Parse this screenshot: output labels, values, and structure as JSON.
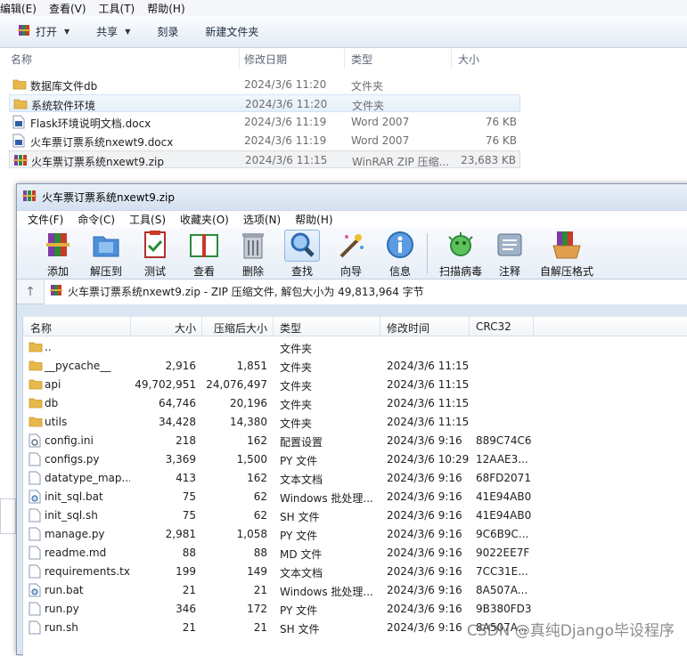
{
  "explorer": {
    "menu": [
      "编辑(E)",
      "查看(V)",
      "工具(T)",
      "帮助(H)"
    ],
    "commands": [
      {
        "label": "打开",
        "dropdown": true
      },
      {
        "label": "共享",
        "dropdown": true
      },
      {
        "label": "刻录",
        "dropdown": false
      },
      {
        "label": "新建文件夹",
        "dropdown": false
      }
    ],
    "columns": {
      "name": "名称",
      "date": "修改日期",
      "type": "类型",
      "size": "大小"
    },
    "files": [
      {
        "name": "数据库文件db",
        "date": "2024/3/6 11:20",
        "type": "文件夹",
        "size": "",
        "icon": "folder-icon"
      },
      {
        "name": "系统软件环境",
        "date": "2024/3/6 11:20",
        "type": "文件夹",
        "size": "",
        "icon": "folder-icon"
      },
      {
        "name": "Flask环境说明文档.docx",
        "date": "2024/3/6 11:19",
        "type": "Word 2007",
        "size": "76 KB",
        "icon": "docx-icon"
      },
      {
        "name": "火车票订票系统nxewt9.docx",
        "date": "2024/3/6 11:19",
        "type": "Word 2007",
        "size": "76 KB",
        "icon": "docx-icon"
      },
      {
        "name": "火车票订票系统nxewt9.zip",
        "date": "2024/3/6 11:15",
        "type": "WinRAR ZIP 压缩...",
        "size": "23,683 KB",
        "icon": "winrar-icon"
      }
    ]
  },
  "winrar": {
    "title": "火车票订票系统nxewt9.zip",
    "menu": [
      "文件(F)",
      "命令(C)",
      "工具(S)",
      "收藏夹(O)",
      "选项(N)",
      "帮助(H)"
    ],
    "toolbar": [
      {
        "label": "添加",
        "icon": "add-icon"
      },
      {
        "label": "解压到",
        "icon": "extract-icon"
      },
      {
        "label": "测试",
        "icon": "test-icon"
      },
      {
        "label": "查看",
        "icon": "view-icon"
      },
      {
        "label": "删除",
        "icon": "delete-icon"
      },
      {
        "label": "查找",
        "icon": "find-icon"
      },
      {
        "label": "向导",
        "icon": "wizard-icon"
      },
      {
        "label": "信息",
        "icon": "info-icon"
      },
      {
        "label": "扫描病毒",
        "icon": "virus-scan-icon"
      },
      {
        "label": "注释",
        "icon": "comment-icon"
      },
      {
        "label": "自解压格式",
        "icon": "sfx-icon"
      }
    ],
    "address": "火车票订票系统nxewt9.zip - ZIP 压缩文件, 解包大小为 49,813,964 字节",
    "columns": {
      "name": "名称",
      "size": "大小",
      "packed": "压缩后大小",
      "type": "类型",
      "modified": "修改时间",
      "crc": "CRC32"
    },
    "rows": [
      {
        "name": "..",
        "size": "",
        "packed": "",
        "type": "文件夹",
        "modified": "",
        "crc": "",
        "icon": "folder-icon"
      },
      {
        "name": "__pycache__",
        "size": "2,916",
        "packed": "1,851",
        "type": "文件夹",
        "modified": "2024/3/6 11:15",
        "crc": "",
        "icon": "folder-icon"
      },
      {
        "name": "api",
        "size": "49,702,951",
        "packed": "24,076,497",
        "type": "文件夹",
        "modified": "2024/3/6 11:15",
        "crc": "",
        "icon": "folder-icon"
      },
      {
        "name": "db",
        "size": "64,746",
        "packed": "20,196",
        "type": "文件夹",
        "modified": "2024/3/6 11:15",
        "crc": "",
        "icon": "folder-icon"
      },
      {
        "name": "utils",
        "size": "34,428",
        "packed": "14,380",
        "type": "文件夹",
        "modified": "2024/3/6 11:15",
        "crc": "",
        "icon": "folder-icon"
      },
      {
        "name": "config.ini",
        "size": "218",
        "packed": "162",
        "type": "配置设置",
        "modified": "2024/3/6 9:16",
        "crc": "889C74C6",
        "icon": "ini-file-icon"
      },
      {
        "name": "configs.py",
        "size": "3,369",
        "packed": "1,500",
        "type": "PY 文件",
        "modified": "2024/3/6 10:29",
        "crc": "12AAE3...",
        "icon": "file-icon"
      },
      {
        "name": "datatype_map....",
        "size": "413",
        "packed": "162",
        "type": "文本文档",
        "modified": "2024/3/6 9:16",
        "crc": "68FD2071",
        "icon": "file-icon"
      },
      {
        "name": "init_sql.bat",
        "size": "75",
        "packed": "62",
        "type": "Windows 批处理...",
        "modified": "2024/3/6 9:16",
        "crc": "41E94AB0",
        "icon": "bat-file-icon"
      },
      {
        "name": "init_sql.sh",
        "size": "75",
        "packed": "62",
        "type": "SH 文件",
        "modified": "2024/3/6 9:16",
        "crc": "41E94AB0",
        "icon": "file-icon"
      },
      {
        "name": "manage.py",
        "size": "2,981",
        "packed": "1,058",
        "type": "PY 文件",
        "modified": "2024/3/6 9:16",
        "crc": "9C6B9C...",
        "icon": "file-icon"
      },
      {
        "name": "readme.md",
        "size": "88",
        "packed": "88",
        "type": "MD 文件",
        "modified": "2024/3/6 9:16",
        "crc": "9022EE7F",
        "icon": "file-icon"
      },
      {
        "name": "requirements.txt",
        "size": "199",
        "packed": "149",
        "type": "文本文档",
        "modified": "2024/3/6 9:16",
        "crc": "7CC31E...",
        "icon": "file-icon"
      },
      {
        "name": "run.bat",
        "size": "21",
        "packed": "21",
        "type": "Windows 批处理...",
        "modified": "2024/3/6 9:16",
        "crc": "8A507A...",
        "icon": "bat-file-icon"
      },
      {
        "name": "run.py",
        "size": "346",
        "packed": "172",
        "type": "PY 文件",
        "modified": "2024/3/6 9:16",
        "crc": "9B380FD3",
        "icon": "file-icon"
      },
      {
        "name": "run.sh",
        "size": "21",
        "packed": "21",
        "type": "SH 文件",
        "modified": "2024/3/6 9:16",
        "crc": "8A507A...",
        "icon": "file-icon"
      }
    ]
  },
  "watermark": "CSDN @真纯Django毕设程序",
  "colors": {
    "accent": "#3a78c9",
    "folder": "#e8b84a",
    "titlebar": "#d4e1f0"
  }
}
